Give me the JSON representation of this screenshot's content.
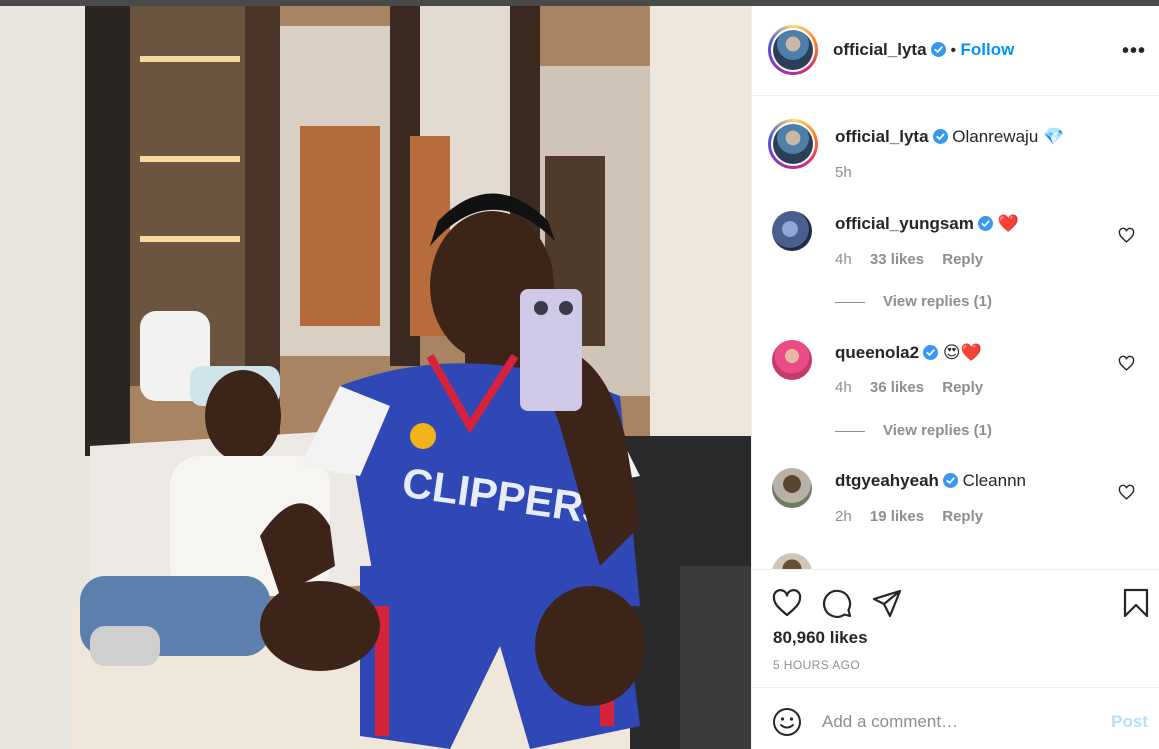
{
  "colors": {
    "accent": "#0095f6",
    "verified": "#3897f0",
    "heart_red": "#ed4956",
    "muted_text": "#8e8e8e",
    "post_disabled": "#b2dffc"
  },
  "header": {
    "username": "official_lyta",
    "separator": "•",
    "follow_label": "Follow",
    "more_label": "•••"
  },
  "caption": {
    "username": "official_lyta",
    "text": "Olanrewaju 💎",
    "time": "5h"
  },
  "comments": [
    {
      "username": "official_yungsam",
      "text": "❤️",
      "time": "4h",
      "likes": "33 likes",
      "reply_label": "Reply",
      "view_replies": "View replies (1)"
    },
    {
      "username": "queenola2",
      "text": "😍❤️",
      "time": "4h",
      "likes": "36 likes",
      "reply_label": "Reply",
      "view_replies": "View replies (1)"
    },
    {
      "username": "dtgyeahyeah",
      "text": "Cleannn",
      "time": "2h",
      "likes": "19 likes",
      "reply_label": "Reply"
    }
  ],
  "icons": {
    "like": "heart-icon",
    "comment": "comment-icon",
    "share": "share-icon",
    "save": "bookmark-icon",
    "emoji": "emoji-icon",
    "verified": "verified-badge-icon",
    "more": "more-options-icon"
  },
  "post": {
    "likes": "80,960 likes",
    "time_ago": "5 HOURS AGO"
  },
  "add_comment": {
    "placeholder": "Add a comment…",
    "post_label": "Post"
  }
}
